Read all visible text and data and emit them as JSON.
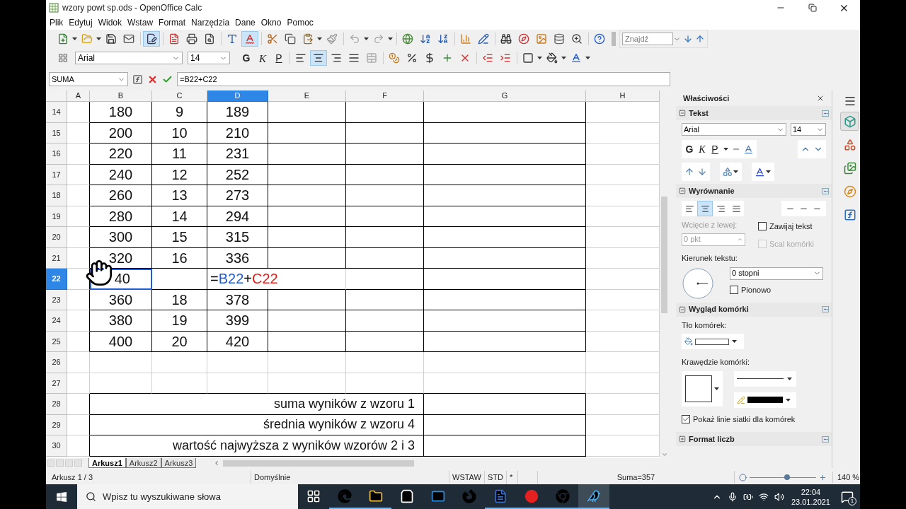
{
  "window": {
    "title": "wzory powt sp.ods - OpenOffice Calc"
  },
  "menu": [
    "Plik",
    "Edytuj",
    "Widok",
    "Wstaw",
    "Format",
    "Narzędzia",
    "Dane",
    "Okno",
    "Pomoc"
  ],
  "standard_toolbar": [
    {
      "kind": "new",
      "on": false
    },
    {
      "kind": "open",
      "on": false
    },
    {
      "kind": "save",
      "on": false
    },
    {
      "kind": "mail",
      "on": false
    },
    {
      "kind": "edit",
      "on": true
    },
    {
      "kind": "pdf",
      "on": false
    },
    {
      "kind": "print",
      "on": false
    },
    {
      "kind": "preview",
      "on": false
    },
    {
      "kind": "spell",
      "on": false
    },
    {
      "kind": "autospell",
      "on": true
    },
    {
      "kind": "cut",
      "on": false
    },
    {
      "kind": "copy",
      "on": false
    },
    {
      "kind": "paste",
      "on": false
    },
    {
      "kind": "brush",
      "on": false
    },
    {
      "kind": "undo",
      "on": false
    },
    {
      "kind": "redo",
      "on": false
    },
    {
      "kind": "globe",
      "on": false
    },
    {
      "kind": "sort-asc",
      "on": false
    },
    {
      "kind": "sort-desc",
      "on": false
    },
    {
      "kind": "chart",
      "on": false
    },
    {
      "kind": "draw",
      "on": false
    },
    {
      "kind": "find",
      "on": false
    },
    {
      "kind": "navigator",
      "on": false
    },
    {
      "kind": "gallery",
      "on": false
    },
    {
      "kind": "database",
      "on": false
    },
    {
      "kind": "zoom",
      "on": false
    },
    {
      "kind": "help",
      "on": false
    }
  ],
  "find_toolbar": {
    "placeholder": "Znajdź"
  },
  "formatting_toolbar": {
    "font": "Arial",
    "size": "14",
    "buttons": [
      {
        "kind": "bold",
        "label": "G",
        "on": false
      },
      {
        "kind": "italic",
        "label": "K",
        "on": false
      },
      {
        "kind": "underline",
        "label": "P",
        "on": false
      },
      {
        "kind": "align-left",
        "on": false
      },
      {
        "kind": "align-center",
        "on": true
      },
      {
        "kind": "align-right",
        "on": false
      },
      {
        "kind": "justify",
        "on": false
      },
      {
        "kind": "merge",
        "on": false
      },
      {
        "kind": "currency",
        "on": false
      },
      {
        "kind": "percent",
        "on": false
      },
      {
        "kind": "number",
        "on": false
      },
      {
        "kind": "add-decimal",
        "on": false
      },
      {
        "kind": "remove-decimal",
        "on": false
      },
      {
        "kind": "indent-less",
        "on": false
      },
      {
        "kind": "indent-more",
        "on": false
      },
      {
        "kind": "borders",
        "on": false
      },
      {
        "kind": "background",
        "on": false
      },
      {
        "kind": "font-color",
        "on": false
      }
    ]
  },
  "formula_bar": {
    "name_box": "SUMA",
    "formula": "=B22+C22"
  },
  "sheet": {
    "columns": [
      {
        "label": "A",
        "selected": false
      },
      {
        "label": "B",
        "selected": false
      },
      {
        "label": "C",
        "selected": false
      },
      {
        "label": "D",
        "selected": true
      },
      {
        "label": "E",
        "selected": false
      },
      {
        "label": "F",
        "selected": false
      },
      {
        "label": "G",
        "selected": false
      },
      {
        "label": "H",
        "selected": false
      }
    ],
    "rows": [
      {
        "label": "14",
        "selected": false,
        "kind": "data",
        "b": "180",
        "c": "9",
        "d": "189"
      },
      {
        "label": "15",
        "selected": false,
        "kind": "data",
        "b": "200",
        "c": "10",
        "d": "210"
      },
      {
        "label": "16",
        "selected": false,
        "kind": "data",
        "b": "220",
        "c": "11",
        "d": "231"
      },
      {
        "label": "17",
        "selected": false,
        "kind": "data",
        "b": "240",
        "c": "12",
        "d": "252"
      },
      {
        "label": "18",
        "selected": false,
        "kind": "data",
        "b": "260",
        "c": "13",
        "d": "273"
      },
      {
        "label": "19",
        "selected": false,
        "kind": "data",
        "b": "280",
        "c": "14",
        "d": "294"
      },
      {
        "label": "20",
        "selected": false,
        "kind": "data",
        "b": "300",
        "c": "15",
        "d": "315"
      },
      {
        "label": "21",
        "selected": false,
        "kind": "data",
        "b": "320",
        "c": "16",
        "d": "336"
      },
      {
        "label": "22",
        "selected": true,
        "kind": "editing",
        "b": "40",
        "d_parts": [
          {
            "text": "=",
            "color": "#000000"
          },
          {
            "text": "B22",
            "color": "#1f5bd6"
          },
          {
            "text": "+",
            "color": "#000000"
          },
          {
            "text": "C22",
            "color": "#e0201b"
          }
        ]
      },
      {
        "label": "23",
        "selected": false,
        "kind": "data",
        "b": "360",
        "c": "18",
        "d": "378"
      },
      {
        "label": "24",
        "selected": false,
        "kind": "data",
        "b": "380",
        "c": "19",
        "d": "399"
      },
      {
        "label": "25",
        "selected": false,
        "kind": "data",
        "b": "400",
        "c": "20",
        "d": "420"
      },
      {
        "label": "26",
        "selected": false,
        "kind": "blank"
      },
      {
        "label": "27",
        "selected": false,
        "kind": "blank"
      },
      {
        "label": "28",
        "selected": false,
        "kind": "summary",
        "text": "suma wyników z wzoru 1"
      },
      {
        "label": "29",
        "selected": false,
        "kind": "summary",
        "text": "średnia wyników z wzoru 4"
      },
      {
        "label": "30",
        "selected": false,
        "kind": "summary",
        "text": "wartość najwyższa z wyników wzorów 2 i 3"
      }
    ]
  },
  "sheet_tabs": [
    {
      "label": "Arkusz1",
      "selected": true
    },
    {
      "label": "Arkusz2",
      "selected": false
    },
    {
      "label": "Arkusz3",
      "selected": false
    }
  ],
  "sidebar": {
    "title": "Właściwości",
    "text_section": {
      "title": "Tekst",
      "expanded": true,
      "font": "Arial",
      "size": "14",
      "buttons": [
        {
          "kind": "bold",
          "label": "G"
        },
        {
          "kind": "italic",
          "label": "K"
        },
        {
          "kind": "underline",
          "label": "P"
        }
      ]
    },
    "alignment_section": {
      "title": "Wyrównanie",
      "expanded": true,
      "align": [
        {
          "kind": "left",
          "selected": false
        },
        {
          "kind": "center",
          "selected": true
        },
        {
          "kind": "right",
          "selected": false
        },
        {
          "kind": "justify",
          "selected": false
        }
      ],
      "indent_label": "Wcięcie z lewej:",
      "indent_disabled": true,
      "indent_value": "0 pkt",
      "wrap": {
        "label": "Zawijaj tekst",
        "checked": false,
        "disabled": false
      },
      "merge": {
        "label": "Scal komórki",
        "checked": false,
        "disabled": true
      },
      "direction_label": "Kierunek tekstu:",
      "angle": "0 stopni",
      "vertical": {
        "label": "Pionowo",
        "checked": false,
        "disabled": false
      }
    },
    "cell_section": {
      "title": "Wygląd komórki",
      "expanded": true,
      "background_label": "Tło komórek:",
      "borders_label": "Krawędzie komórki:",
      "gridlines": {
        "label": "Pokaż linie siatki dla komórek",
        "checked": true,
        "disabled": false
      }
    },
    "number_section": {
      "title": "Format liczb",
      "expanded": false
    }
  },
  "deck": [
    {
      "kind": "properties",
      "selected": true
    },
    {
      "kind": "styles",
      "selected": false
    },
    {
      "kind": "gallery",
      "selected": false
    },
    {
      "kind": "navigator",
      "selected": false
    },
    {
      "kind": "functions",
      "selected": false
    }
  ],
  "status_bar": {
    "sheet": "Arkusz 1 / 3",
    "style": "Domyślnie",
    "mode": "WSTAW",
    "selection_mode": "STD",
    "modified": "*",
    "sum": "Suma=357",
    "zoom": {
      "level": 0.56,
      "reading": "140 %"
    }
  },
  "taskbar": {
    "search_placeholder": "Wpisz tu wyszukiwane słowa",
    "apps": [
      {
        "kind": "task-view",
        "running": false,
        "selected": false
      },
      {
        "kind": "edge",
        "running": true,
        "selected": false
      },
      {
        "kind": "folder",
        "running": true,
        "selected": false
      },
      {
        "kind": "store",
        "running": false,
        "selected": false
      },
      {
        "kind": "mail",
        "running": false,
        "selected": false
      },
      {
        "kind": "firefox",
        "running": false,
        "selected": false
      },
      {
        "kind": "word",
        "running": true,
        "selected": false
      },
      {
        "kind": "record",
        "running": true,
        "selected": false
      },
      {
        "kind": "chrome",
        "running": true,
        "selected": false
      },
      {
        "kind": "calc",
        "running": true,
        "selected": true
      }
    ],
    "time": "22:04",
    "date": "23.01.2021",
    "notification_count": "1"
  }
}
